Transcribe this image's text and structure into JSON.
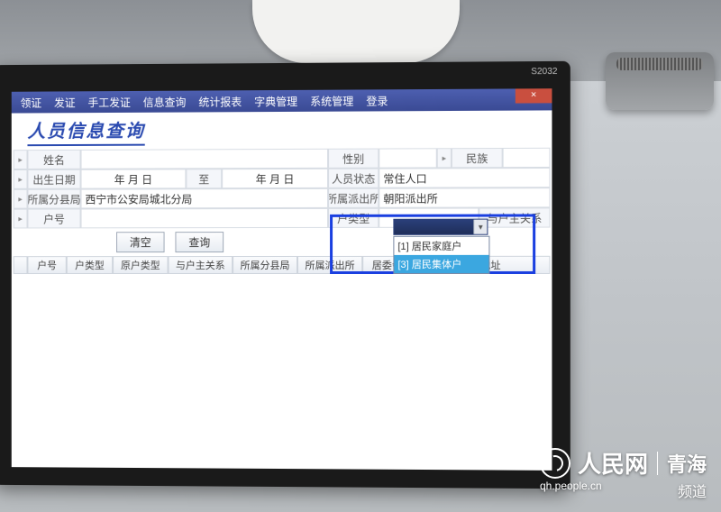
{
  "monitor_model": "S2032",
  "menu": [
    "领证",
    "发证",
    "手工发证",
    "信息查询",
    "统计报表",
    "字典管理",
    "系统管理",
    "登录"
  ],
  "page_title": "人员信息查询",
  "form": {
    "name_lbl": "姓名",
    "gender_lbl": "性别",
    "nation_lbl": "民族",
    "dob_lbl": "出生日期",
    "dob_from": "年  月  日",
    "dob_to_lbl": "至",
    "dob_to": "年  月  日",
    "status_lbl": "人员状态",
    "status_val": "常住人口",
    "bureau_lbl": "所属分县局",
    "bureau_val": "西宁市公安局城北分局",
    "station_lbl": "所属派出所",
    "station_val": "朝阳派出所",
    "hh_no_lbl": "户号",
    "hh_type_lbl": "户类型",
    "head_rel_lbl": "与户主关系"
  },
  "dropdown": {
    "opt1": "[1] 居民家庭户",
    "opt2": "[3] 居民集体户"
  },
  "buttons": {
    "clear": "清空",
    "query": "查询"
  },
  "columns": [
    "",
    "户号",
    "户类型",
    "原户类型",
    "与户主关系",
    "所属分县局",
    "所属派出所",
    "居委会",
    "户籍地址"
  ],
  "watermark": {
    "brand": "人民网",
    "region": "青海",
    "sub": "qh.people.cn",
    "channel": "频道"
  }
}
